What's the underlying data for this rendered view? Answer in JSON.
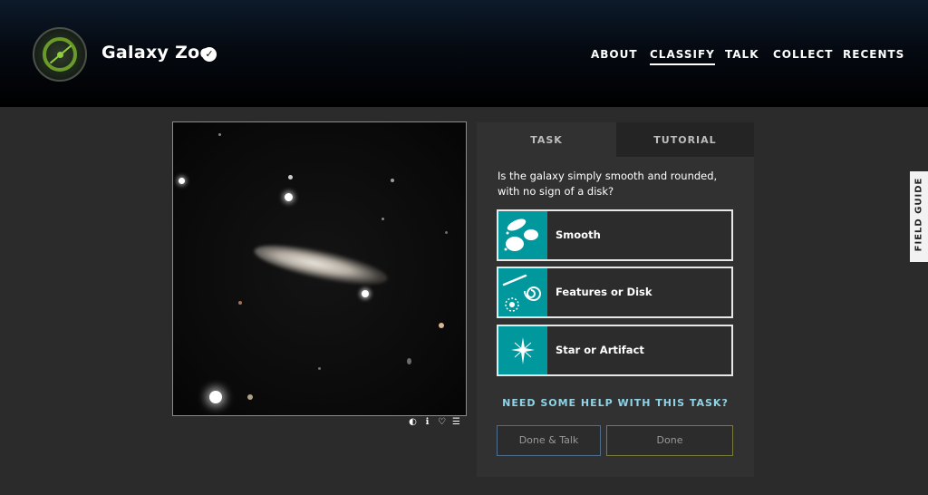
{
  "header": {
    "site_title": "Galaxy Zoo",
    "nav": [
      {
        "label": "ABOUT",
        "active": false
      },
      {
        "label": "CLASSIFY",
        "active": true
      },
      {
        "label": "TALK",
        "active": false
      },
      {
        "label": "COLLECT",
        "active": false
      },
      {
        "label": "RECENTS",
        "active": false
      }
    ],
    "icons": {
      "logo": "galaxy-zoo-logo",
      "verified": "check-icon"
    }
  },
  "image_tools": [
    "invert-icon",
    "info-icon",
    "heart-icon",
    "collections-icon"
  ],
  "task_panel": {
    "tabs": [
      "TASK",
      "TUTORIAL"
    ],
    "question": "Is the galaxy simply smooth and rounded, with no sign of a disk?",
    "answers": [
      {
        "label": "Smooth",
        "icon": "smooth-galaxies-icon"
      },
      {
        "label": "Features or Disk",
        "icon": "spiral-galaxy-icon"
      },
      {
        "label": "Star or Artifact",
        "icon": "star-icon"
      }
    ],
    "help_link": "NEED SOME HELP WITH THIS TASK?",
    "done_talk_label": "Done & Talk",
    "done_label": "Done"
  },
  "field_guide": {
    "label": "FIELD GUIDE"
  },
  "colors": {
    "accent_teal": "#00979d",
    "help_link": "#8fd4e6",
    "background": "#2b2b2b"
  }
}
